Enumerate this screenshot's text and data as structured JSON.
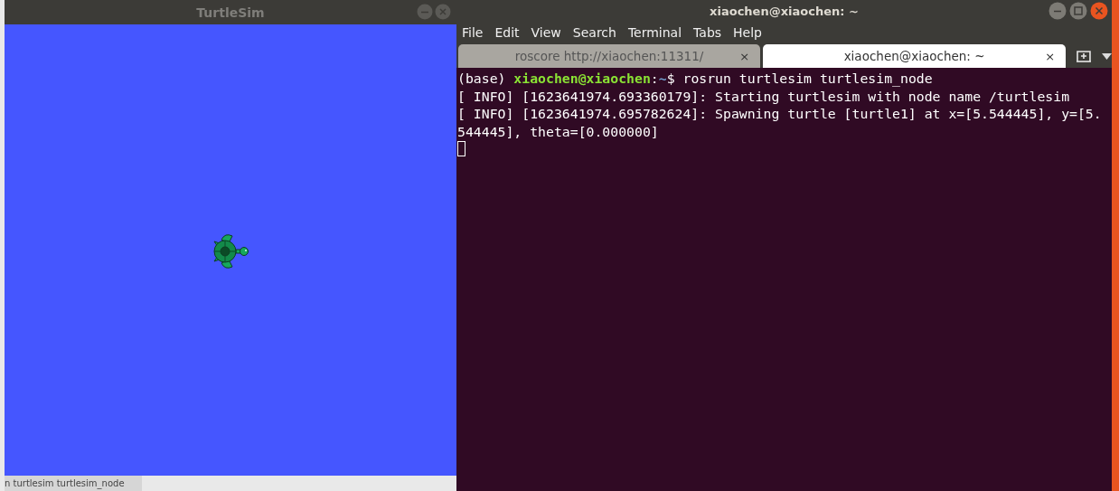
{
  "turtlesim_window": {
    "title": "TurtleSim"
  },
  "background_page": {
    "text": "n turtlesim turtlesim_node"
  },
  "terminal_window": {
    "title": "xiaochen@xiaochen: ~",
    "menu": [
      "File",
      "Edit",
      "View",
      "Search",
      "Terminal",
      "Tabs",
      "Help"
    ],
    "tabs": [
      {
        "label": "roscore http://xiaochen:11311/",
        "close": "×",
        "selected": false
      },
      {
        "label": "xiaochen@xiaochen: ~",
        "close": "×",
        "selected": true
      }
    ],
    "lines": [
      [
        {
          "kind": "plain",
          "text": "(base) "
        },
        {
          "kind": "user",
          "text": "xiaochen@xiaochen"
        },
        {
          "kind": "plain",
          "text": ":"
        },
        {
          "kind": "path",
          "text": "~"
        },
        {
          "kind": "plain",
          "text": "$ rosrun turtlesim turtlesim_node"
        }
      ],
      [
        {
          "kind": "plain",
          "text": "[ INFO] [1623641974.693360179]: Starting turtlesim with node name /turtlesim"
        }
      ],
      [
        {
          "kind": "plain",
          "text": "[ INFO] [1623641974.695782624]: Spawning turtle [turtle1] at x=[5.544445], y=[5."
        }
      ],
      [
        {
          "kind": "plain",
          "text": "544445], theta=[0.000000]"
        }
      ]
    ]
  }
}
